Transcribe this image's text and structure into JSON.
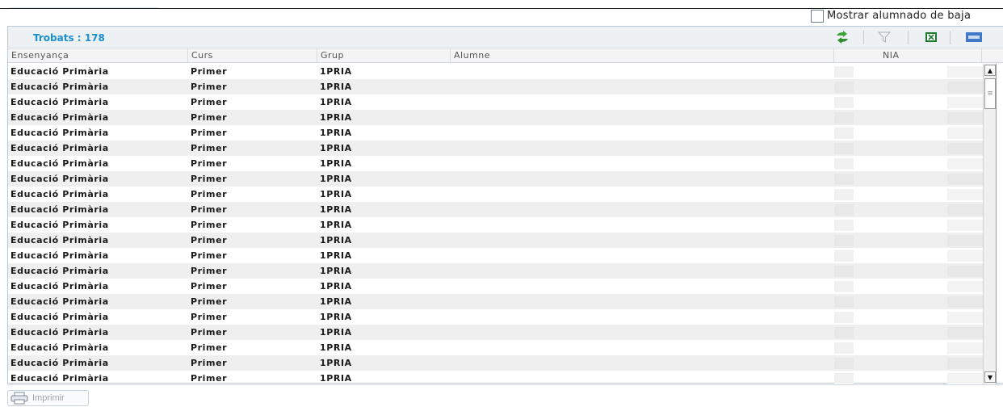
{
  "options": {
    "show_withdrawn_label": "Mostrar alumnado de baja",
    "show_withdrawn_checked": false
  },
  "toolbar": {
    "found_label": "Trobats : 178",
    "icons": [
      "refresh-icon",
      "filter-icon",
      "excel-export-icon",
      "html-export-icon"
    ]
  },
  "columns": {
    "ensenyanca": "Ensenyança",
    "curs": "Curs",
    "grup": "Grup",
    "alumne": "Alumne",
    "nia": "NIA"
  },
  "rows": [
    {
      "ensenyanca": "Educació Primària",
      "curs": "Primer",
      "grup": "1PRIA"
    },
    {
      "ensenyanca": "Educació Primària",
      "curs": "Primer",
      "grup": "1PRIA"
    },
    {
      "ensenyanca": "Educació Primària",
      "curs": "Primer",
      "grup": "1PRIA"
    },
    {
      "ensenyanca": "Educació Primària",
      "curs": "Primer",
      "grup": "1PRIA"
    },
    {
      "ensenyanca": "Educació Primària",
      "curs": "Primer",
      "grup": "1PRIA"
    },
    {
      "ensenyanca": "Educació Primària",
      "curs": "Primer",
      "grup": "1PRIA"
    },
    {
      "ensenyanca": "Educació Primària",
      "curs": "Primer",
      "grup": "1PRIA"
    },
    {
      "ensenyanca": "Educació Primària",
      "curs": "Primer",
      "grup": "1PRIA"
    },
    {
      "ensenyanca": "Educació Primària",
      "curs": "Primer",
      "grup": "1PRIA"
    },
    {
      "ensenyanca": "Educació Primària",
      "curs": "Primer",
      "grup": "1PRIA"
    },
    {
      "ensenyanca": "Educació Primària",
      "curs": "Primer",
      "grup": "1PRIA"
    },
    {
      "ensenyanca": "Educació Primària",
      "curs": "Primer",
      "grup": "1PRIA"
    },
    {
      "ensenyanca": "Educació Primària",
      "curs": "Primer",
      "grup": "1PRIA"
    },
    {
      "ensenyanca": "Educació Primària",
      "curs": "Primer",
      "grup": "1PRIA"
    },
    {
      "ensenyanca": "Educació Primària",
      "curs": "Primer",
      "grup": "1PRIA"
    },
    {
      "ensenyanca": "Educació Primària",
      "curs": "Primer",
      "grup": "1PRIA"
    },
    {
      "ensenyanca": "Educació Primària",
      "curs": "Primer",
      "grup": "1PRIA"
    },
    {
      "ensenyanca": "Educació Primària",
      "curs": "Primer",
      "grup": "1PRIA"
    },
    {
      "ensenyanca": "Educació Primària",
      "curs": "Primer",
      "grup": "1PRIA"
    },
    {
      "ensenyanca": "Educació Primària",
      "curs": "Primer",
      "grup": "1PRIA"
    },
    {
      "ensenyanca": "Educació Primària",
      "curs": "Primer",
      "grup": "1PRIA"
    }
  ],
  "footer": {
    "print_label": "Imprimir",
    "print_icon": "printer-icon"
  },
  "colors": {
    "accent": "#1b8fd0",
    "alt_row": "#efefef",
    "border": "#b9c9d8"
  }
}
